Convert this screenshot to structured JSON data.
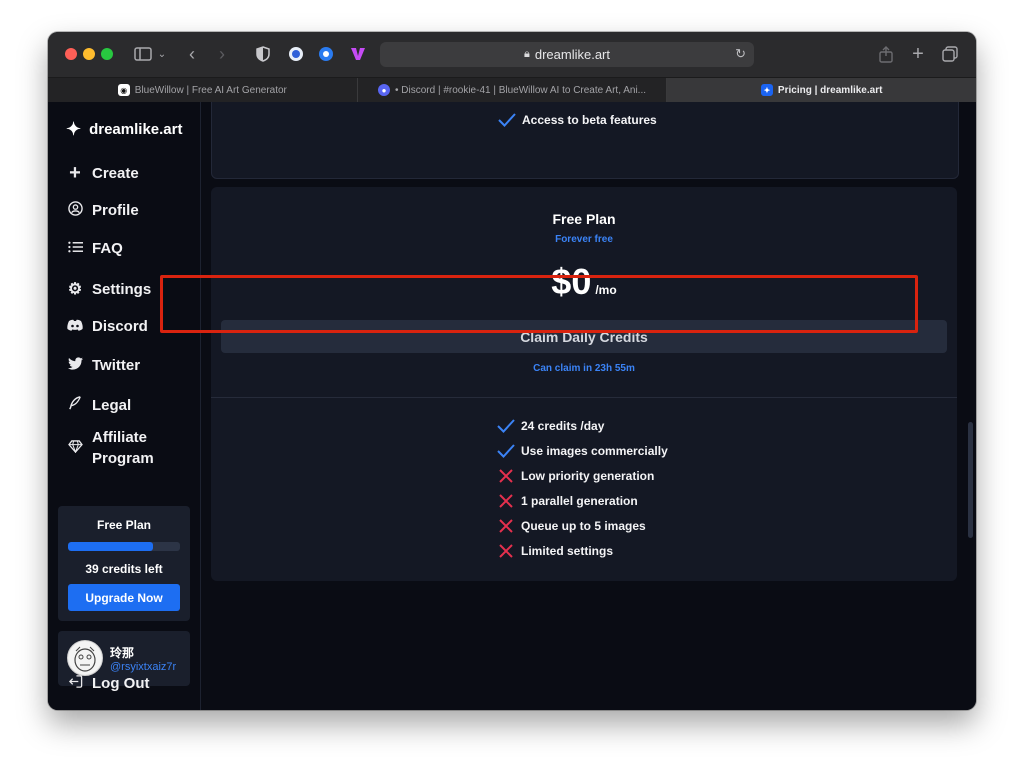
{
  "browser": {
    "address": "dreamlike.art",
    "tabs": [
      {
        "label": "BlueWillow | Free AI Art Generator",
        "active": false
      },
      {
        "label": "• Discord | #rookie-41 | BlueWillow AI to Create Art, Ani...",
        "active": false
      },
      {
        "label": "Pricing | dreamlike.art",
        "active": true
      }
    ]
  },
  "sidebar": {
    "brand": "dreamlike.art",
    "nav": [
      {
        "label": "Create",
        "icon": "plus-icon"
      },
      {
        "label": "Profile",
        "icon": "profile-icon"
      },
      {
        "label": "FAQ",
        "icon": "list-icon"
      },
      {
        "label": "Settings",
        "icon": "gear-icon"
      },
      {
        "label": "Discord",
        "icon": "discord-icon"
      },
      {
        "label": "Twitter",
        "icon": "twitter-icon"
      },
      {
        "label": "Legal",
        "icon": "feather-icon"
      },
      {
        "label": "Affiliate Program",
        "icon": "diamond-icon"
      }
    ],
    "plan": {
      "title": "Free Plan",
      "credits_left": "39 credits left",
      "progress_fraction": 0.76,
      "upgrade_label": "Upgrade Now"
    },
    "user": {
      "name": "玲那",
      "handle": "@rsyixtxaiz7r"
    },
    "logout_label": "Log Out"
  },
  "main": {
    "top_card_feature": "Access to beta features",
    "free_plan": {
      "title": "Free Plan",
      "subtitle": "Forever free",
      "price": "$0",
      "period": "/mo",
      "claim_button": "Claim Daily Credits",
      "claim_note": "Can claim in 23h 55m",
      "features": [
        {
          "text": "24 credits /day",
          "included": true
        },
        {
          "text": "Use images commercially",
          "included": true
        },
        {
          "text": "Low priority generation",
          "included": false
        },
        {
          "text": "1 parallel generation",
          "included": false
        },
        {
          "text": "Queue up to 5 images",
          "included": false
        },
        {
          "text": "Limited settings",
          "included": false
        }
      ]
    }
  },
  "colors": {
    "accent": "#1d6ef2",
    "link": "#3b83f6",
    "check": "#3b83f6",
    "cross": "#e5304e",
    "highlight": "#d9230f"
  }
}
